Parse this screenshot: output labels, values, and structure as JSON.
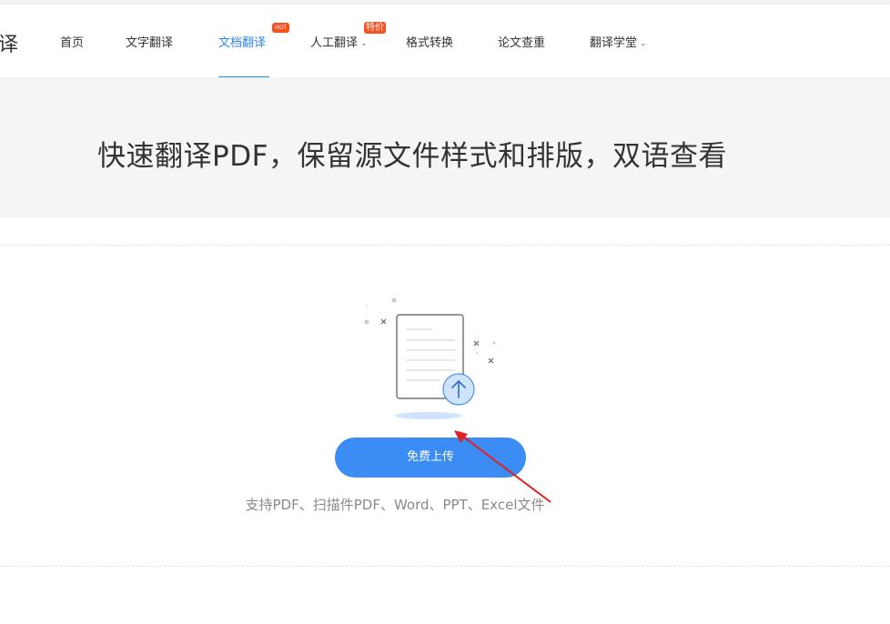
{
  "header": {
    "logo_fragment": "译",
    "nav": [
      {
        "label": "首页"
      },
      {
        "label": "文字翻译"
      },
      {
        "label": "文档翻译",
        "badge": "HOT"
      },
      {
        "label": "人工翻译",
        "badge": "特价"
      },
      {
        "label": "格式转换"
      },
      {
        "label": "论文查重"
      },
      {
        "label": "翻译学堂"
      }
    ],
    "active_color": "#2f86f6",
    "badge_color": "#f4511e"
  },
  "banner": {
    "title": "快速翻译PDF，保留源文件样式和排版，双语查看"
  },
  "upload": {
    "button_label": "免费上传",
    "button_color": "#3b8cf4",
    "support_text": "支持PDF、扫描件PDF、Word、PPT、Excel文件",
    "illustration": "document-upload-icon"
  },
  "annotation": {
    "arrow_color": "#e02020"
  }
}
